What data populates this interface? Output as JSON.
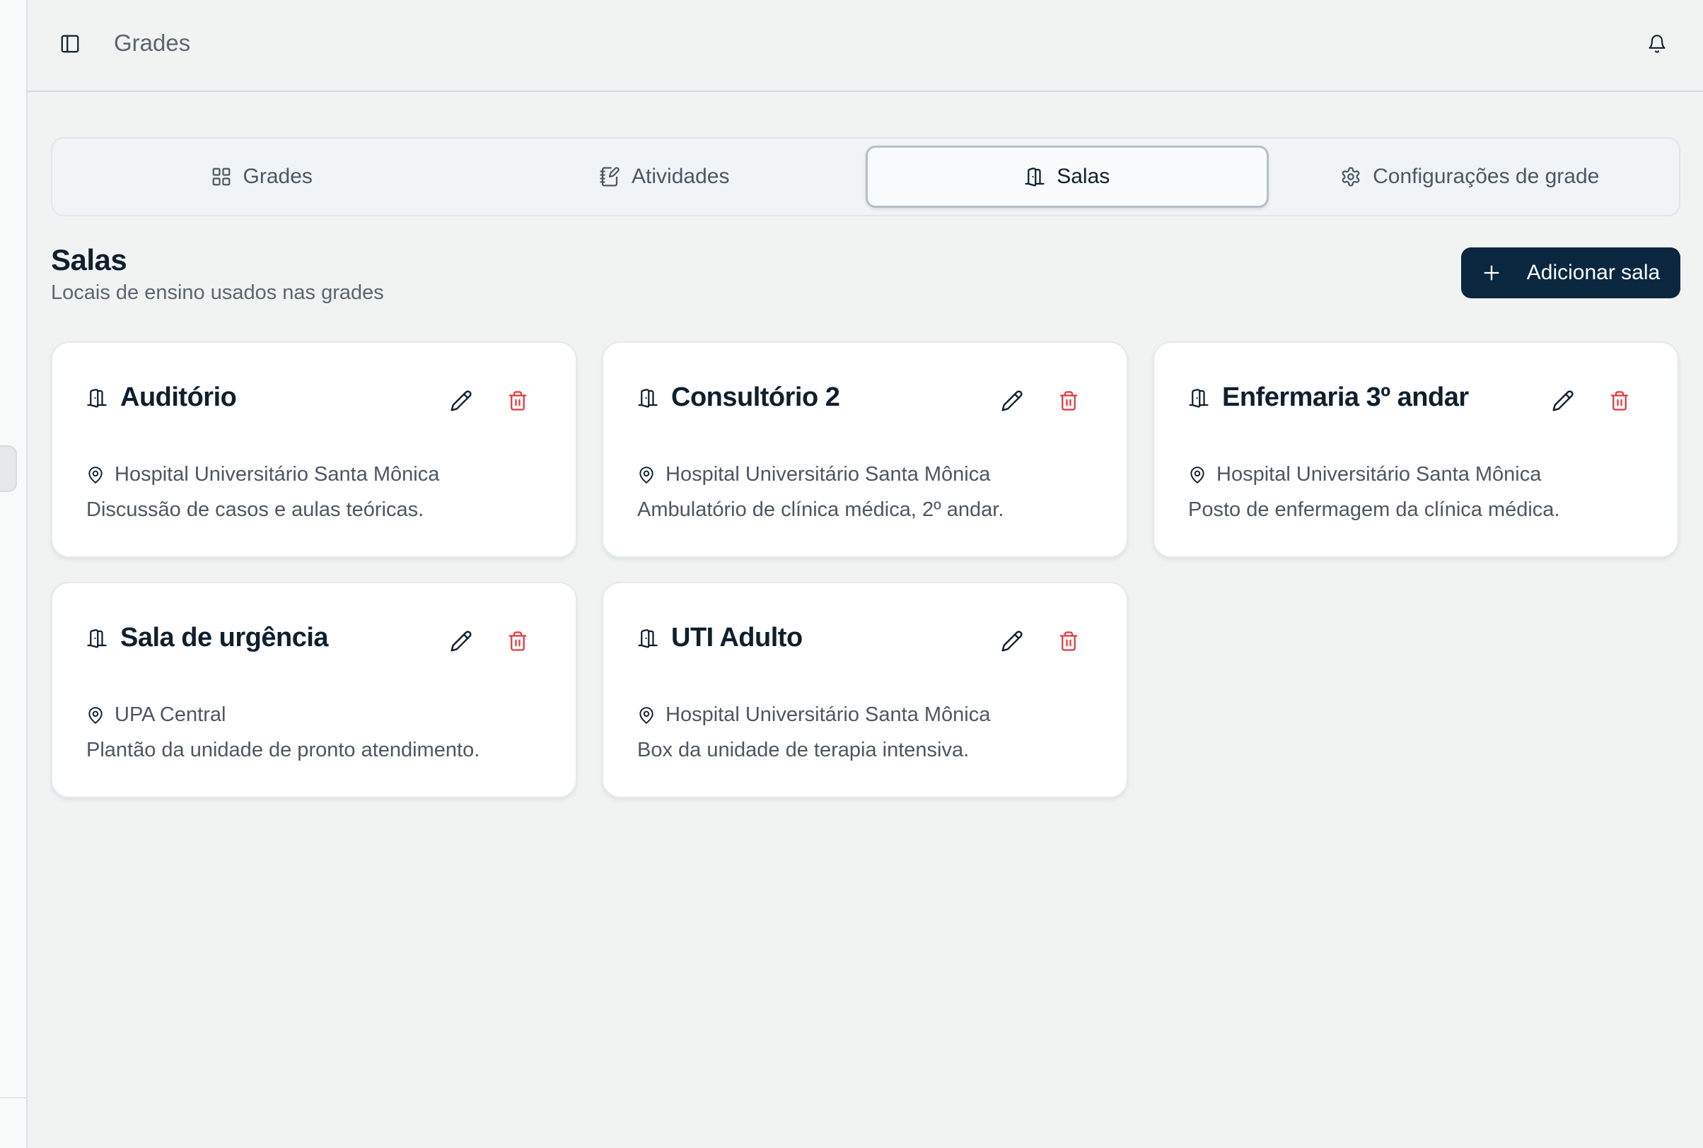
{
  "header": {
    "title": "Grades"
  },
  "tabs": [
    {
      "label": "Grades",
      "icon": "grid-icon"
    },
    {
      "label": "Atividades",
      "icon": "notebook-pen-icon"
    },
    {
      "label": "Salas",
      "icon": "door-icon",
      "active": true
    },
    {
      "label": "Configurações de grade",
      "icon": "gear-icon"
    }
  ],
  "section": {
    "title": "Salas",
    "subtitle": "Locais de ensino usados nas grades",
    "add_label": "Adicionar sala"
  },
  "rooms": [
    {
      "name": "Auditório",
      "location": "Hospital Universitário Santa Mônica",
      "description": "Discussão de casos e aulas teóricas."
    },
    {
      "name": "Consultório 2",
      "location": "Hospital Universitário Santa Mônica",
      "description": "Ambulatório de clínica médica, 2º andar."
    },
    {
      "name": "Enfermaria 3º andar",
      "location": "Hospital Universitário Santa Mônica",
      "description": "Posto de enfermagem da clínica médica."
    },
    {
      "name": "Sala de urgência",
      "location": "UPA Central",
      "description": "Plantão da unidade de pronto atendimento."
    },
    {
      "name": "UTI Adulto",
      "location": "Hospital Universitário Santa Mônica",
      "description": "Box da unidade de terapia intensiva."
    }
  ],
  "colors": {
    "primary": "#0b2740",
    "danger": "#e0393e",
    "background": "#f1f3f3"
  }
}
